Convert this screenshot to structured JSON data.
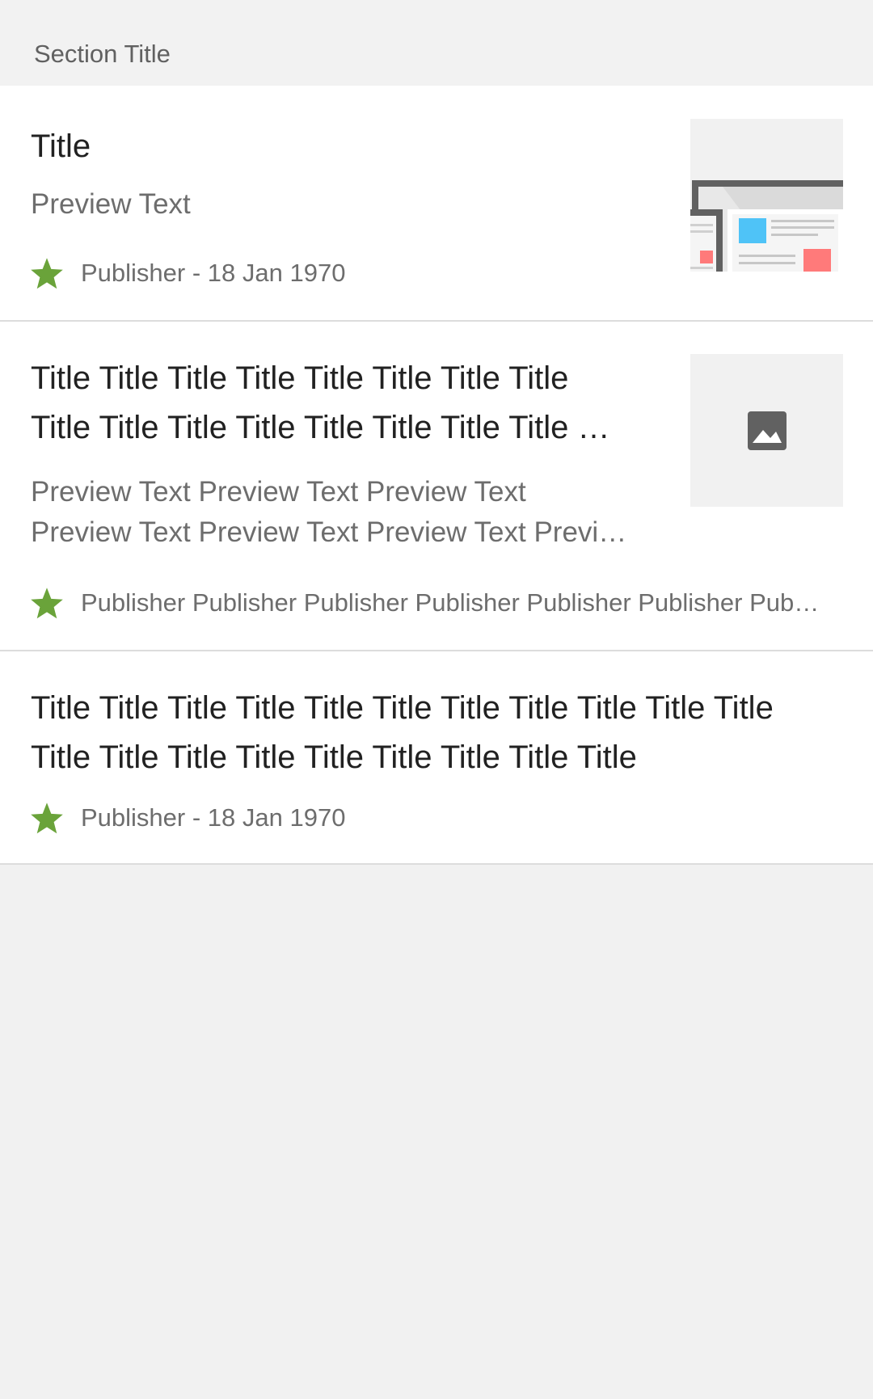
{
  "section": {
    "title": "Section Title"
  },
  "articles": [
    {
      "title": "Title",
      "preview": "Preview Text",
      "meta": "Publisher - 18 Jan 1970",
      "thumbnail": "article-illustration"
    },
    {
      "title_line1": "Title Title Title Title Title Title Title Title",
      "title_line2": "Title Title Title Title Title Title Title Title …",
      "preview_line1": "Preview Text Preview Text Preview Text",
      "preview_line2": "Preview Text Preview Text Preview Text Previ…",
      "meta": "Publisher Publisher Publisher Publisher Publisher Publisher Pub…",
      "thumbnail": "image-placeholder-icon"
    },
    {
      "title_line1": "Title Title Title Title Title Title Title Title Title Title Title",
      "title_line2": "Title Title Title Title Title Title Title Title Title",
      "meta": "Publisher - 18 Jan 1970"
    }
  ],
  "colors": {
    "star": "#6aa33a",
    "background": "#f1f1f1",
    "card": "#ffffff",
    "divider": "#dcdcdc",
    "title_text": "#212121",
    "secondary_text": "#6d6d6d"
  }
}
